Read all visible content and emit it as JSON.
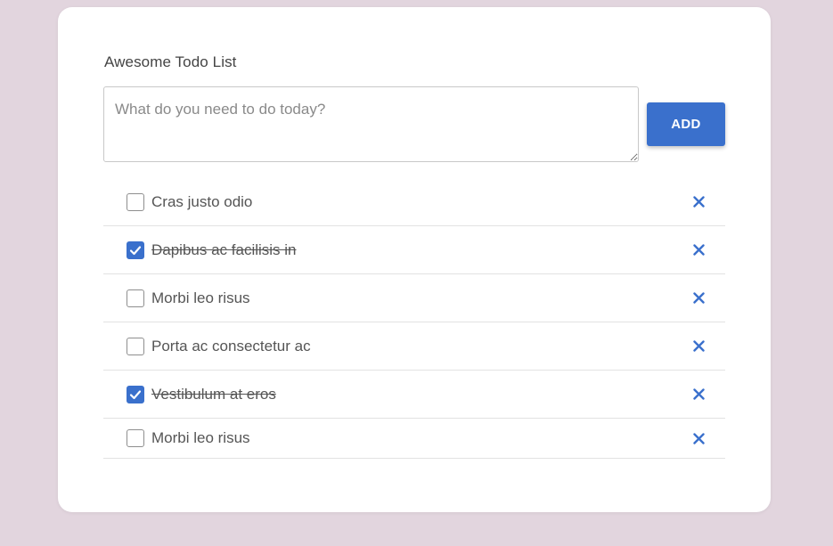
{
  "app": {
    "title": "Awesome Todo List"
  },
  "input": {
    "value": "",
    "placeholder": "What do you need to do today?"
  },
  "add_button": {
    "label": "ADD"
  },
  "todos": [
    {
      "label": "Cras justo odio",
      "done": false
    },
    {
      "label": "Dapibus ac facilisis in",
      "done": true
    },
    {
      "label": "Morbi leo risus",
      "done": false
    },
    {
      "label": "Porta ac consectetur ac",
      "done": false
    },
    {
      "label": "Vestibulum at eros",
      "done": true
    },
    {
      "label": "Morbi leo risus",
      "done": false
    }
  ],
  "icons": {
    "delete": "close-icon",
    "check": "checkmark-icon"
  },
  "colors": {
    "background": "#e2d5de",
    "accent": "#3a70cc",
    "card": "#ffffff",
    "text": "#555555"
  }
}
